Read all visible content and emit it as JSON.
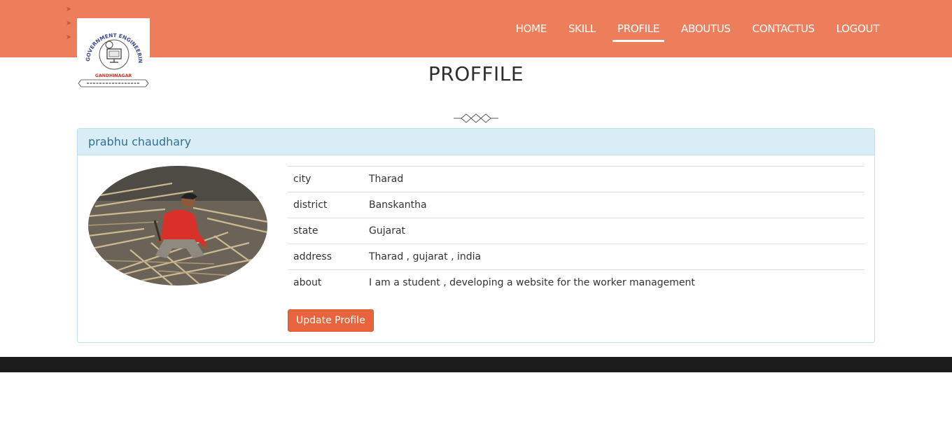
{
  "header": {
    "logo": {
      "arc_text": "GOVERNMENT ENGINEERING COLLEGE",
      "city": "GANDHINAGAR"
    },
    "nav": [
      {
        "label": "HOME"
      },
      {
        "label": "SKILL"
      },
      {
        "label": "PROFILE",
        "active": true
      },
      {
        "label": "ABOUTUS"
      },
      {
        "label": "CONTACTUS"
      },
      {
        "label": "LOGOUT"
      }
    ]
  },
  "page": {
    "title": "PROFFILE"
  },
  "profile": {
    "name": "prabhu chaudhary",
    "rows": [
      {
        "key": "city",
        "value": "Tharad"
      },
      {
        "key": "district",
        "value": "Banskantha"
      },
      {
        "key": "state",
        "value": "Gujarat"
      },
      {
        "key": "address",
        "value": "Tharad , gujarat , india"
      },
      {
        "key": "about",
        "value": "I am a student , developing a website for the worker management"
      }
    ],
    "update_button": "Update Profile"
  },
  "colors": {
    "header_bg": "#ed7e5c",
    "button_bg": "#e8643d",
    "panel_heading_bg": "#d9edf7",
    "panel_heading_text": "#31708f",
    "footer_bg": "#1b1b1b"
  }
}
